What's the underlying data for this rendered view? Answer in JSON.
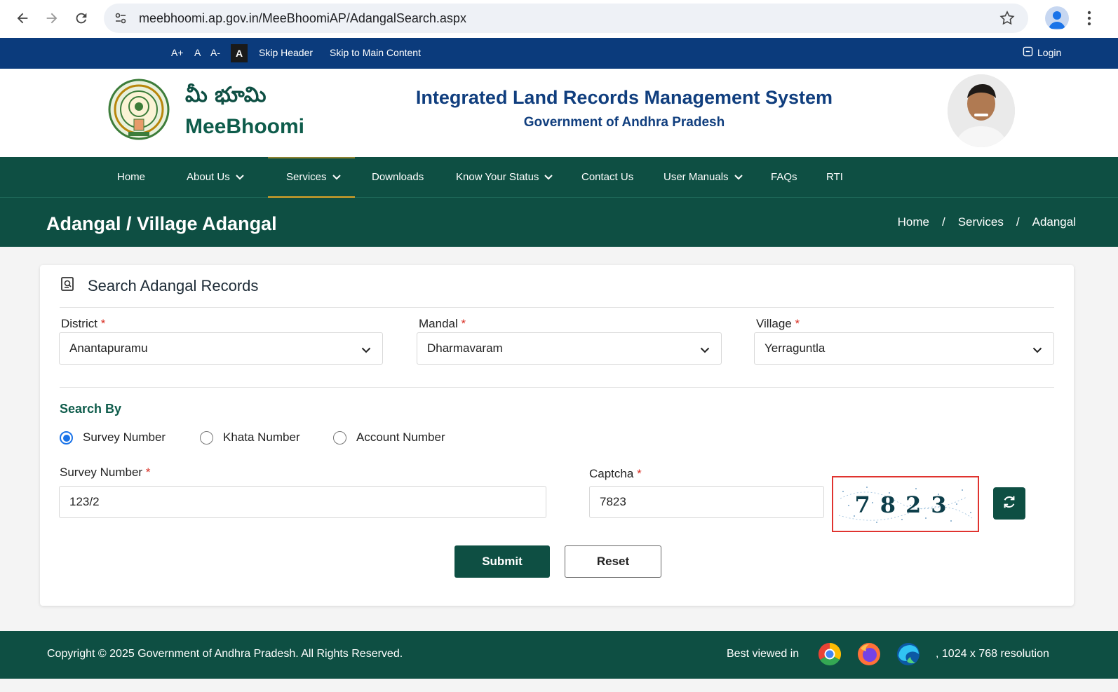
{
  "browser": {
    "url": "meebhoomi.ap.gov.in/MeeBhoomiAP/AdangalSearch.aspx"
  },
  "accessibility": {
    "font_increase": "A+",
    "font_normal": "A",
    "font_decrease": "A-",
    "contrast": "A",
    "skip_header": "Skip Header",
    "skip_main": "Skip to Main Content",
    "login": "Login"
  },
  "header": {
    "brand_telugu": "మీ భూమి",
    "brand_english": "MeeBhoomi",
    "system_title": "Integrated Land Records Management System",
    "system_subtitle": "Government of Andhra Pradesh"
  },
  "nav": {
    "items": [
      {
        "label": "Home"
      },
      {
        "label": "About Us"
      },
      {
        "label": "Services"
      },
      {
        "label": "Downloads"
      },
      {
        "label": "Know Your Status"
      },
      {
        "label": "Contact Us"
      },
      {
        "label": "User Manuals"
      },
      {
        "label": "FAQs"
      },
      {
        "label": "RTI"
      }
    ]
  },
  "page": {
    "title": "Adangal / Village Adangal",
    "breadcrumb": [
      "Home",
      "/",
      "Services",
      "/",
      "Adangal"
    ]
  },
  "form": {
    "card_title": "Search Adangal Records",
    "district_label": "District",
    "district_value": "Anantapuramu",
    "mandal_label": "Mandal",
    "mandal_value": "Dharmavaram",
    "village_label": "Village",
    "village_value": "Yerraguntla",
    "required_mark": "*",
    "search_by_label": "Search By",
    "radios": [
      {
        "label": "Survey Number",
        "checked": true
      },
      {
        "label": "Khata Number",
        "checked": false
      },
      {
        "label": "Account Number",
        "checked": false
      }
    ],
    "survey_label": "Survey Number",
    "survey_value": "123/2",
    "captcha_label": "Captcha",
    "captcha_value": "7823",
    "captcha_image_text": "7823",
    "submit_label": "Submit",
    "reset_label": "Reset"
  },
  "footer": {
    "copyright": "Copyright © 2025 Government of Andhra Pradesh. All Rights Reserved.",
    "best_viewed": "Best viewed in",
    "resolution": ", 1024 x 768 resolution",
    "browser_icons": [
      "chrome-icon",
      "firefox-icon",
      "edge-icon"
    ]
  },
  "colors": {
    "primary_green": "#0e4f43",
    "top_blue": "#0b3b7c",
    "title_blue": "#103e7e",
    "accent_gold": "#e0a526",
    "required_red": "#d93025",
    "radio_blue": "#1a73e8"
  }
}
